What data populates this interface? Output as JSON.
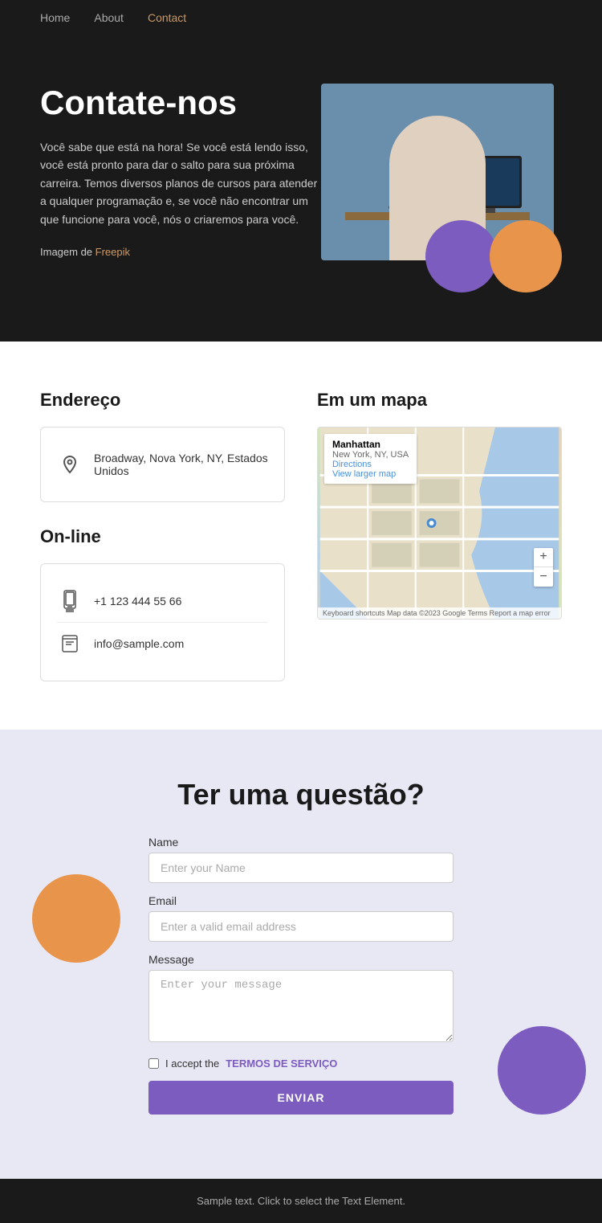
{
  "nav": {
    "items": [
      {
        "label": "Home",
        "active": false
      },
      {
        "label": "About",
        "active": false
      },
      {
        "label": "Contact",
        "active": true
      }
    ]
  },
  "hero": {
    "title": "Contate-nos",
    "body": "Você sabe que está na hora! Se você está lendo isso, você está pronto para dar o salto para sua próxima carreira. Temos diversos planos de cursos para atender a qualquer programação e, se você não encontrar um que funcione para você, nós o criaremos para você.",
    "credit_prefix": "Imagem de ",
    "credit_link_text": "Freepik",
    "credit_link_url": "#"
  },
  "address_section": {
    "title": "Endereço",
    "address": "Broadway, Nova York, NY, Estados Unidos"
  },
  "online_section": {
    "title": "On-line",
    "phone": "+1 123 444 55 66",
    "email": "info@sample.com"
  },
  "map_section": {
    "title": "Em um mapa",
    "location_name": "Manhattan",
    "location_sub": "New York, NY, USA",
    "directions_label": "Directions",
    "larger_map_label": "View larger map",
    "footer_text": "Keyboard shortcuts  Map data ©2023 Google  Terms  Report a map error"
  },
  "form_section": {
    "title": "Ter uma questão?",
    "name_label": "Name",
    "name_placeholder": "Enter your Name",
    "email_label": "Email",
    "email_placeholder": "Enter a valid email address",
    "message_label": "Message",
    "message_placeholder": "Enter your message",
    "terms_prefix": "I accept the ",
    "terms_link": "TERMOS DE SERVIÇO",
    "submit_label": "ENVIAR"
  },
  "footer": {
    "text": "Sample text. Click to select the Text Element."
  }
}
